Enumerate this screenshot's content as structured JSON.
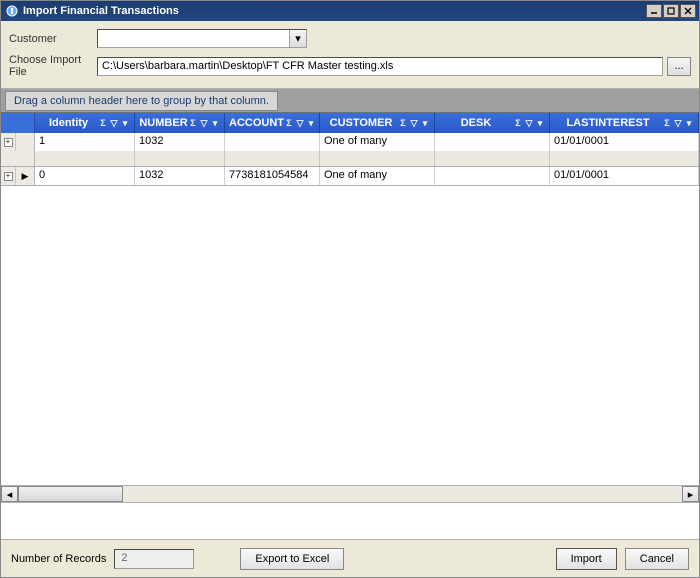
{
  "window": {
    "title": "Import Financial Transactions"
  },
  "form": {
    "customer_label": "Customer",
    "customer_value": "",
    "file_label": "Choose Import File",
    "file_value": "C:\\Users\\barbara.martin\\Desktop\\FT CFR Master testing.xls",
    "browse_glyph": "..."
  },
  "group_hint": "Drag a column header here to group by that column.",
  "columns": [
    {
      "key": "identity",
      "label": "Identity"
    },
    {
      "key": "number",
      "label": "NUMBER"
    },
    {
      "key": "account",
      "label": "ACCOUNT"
    },
    {
      "key": "customer",
      "label": "CUSTOMER"
    },
    {
      "key": "desk",
      "label": "DESK"
    },
    {
      "key": "lastinterest",
      "label": "LASTINTEREST"
    }
  ],
  "glyphs": {
    "sigma": "Σ",
    "funnel": "▽",
    "arrow": "▾"
  },
  "rows": [
    {
      "indicator": "",
      "identity": "1",
      "number": "1032",
      "account": "",
      "customer": "One of many",
      "desk": "",
      "lastinterest": "01/01/0001"
    },
    {
      "indicator": "▶",
      "identity": "0",
      "number": "1032",
      "account": "7738181054584",
      "customer": "One of many",
      "desk": "",
      "lastinterest": "01/01/0001"
    }
  ],
  "footer": {
    "records_label": "Number of Records",
    "records_value": "2",
    "export_label": "Export to Excel",
    "import_label": "Import",
    "cancel_label": "Cancel"
  }
}
